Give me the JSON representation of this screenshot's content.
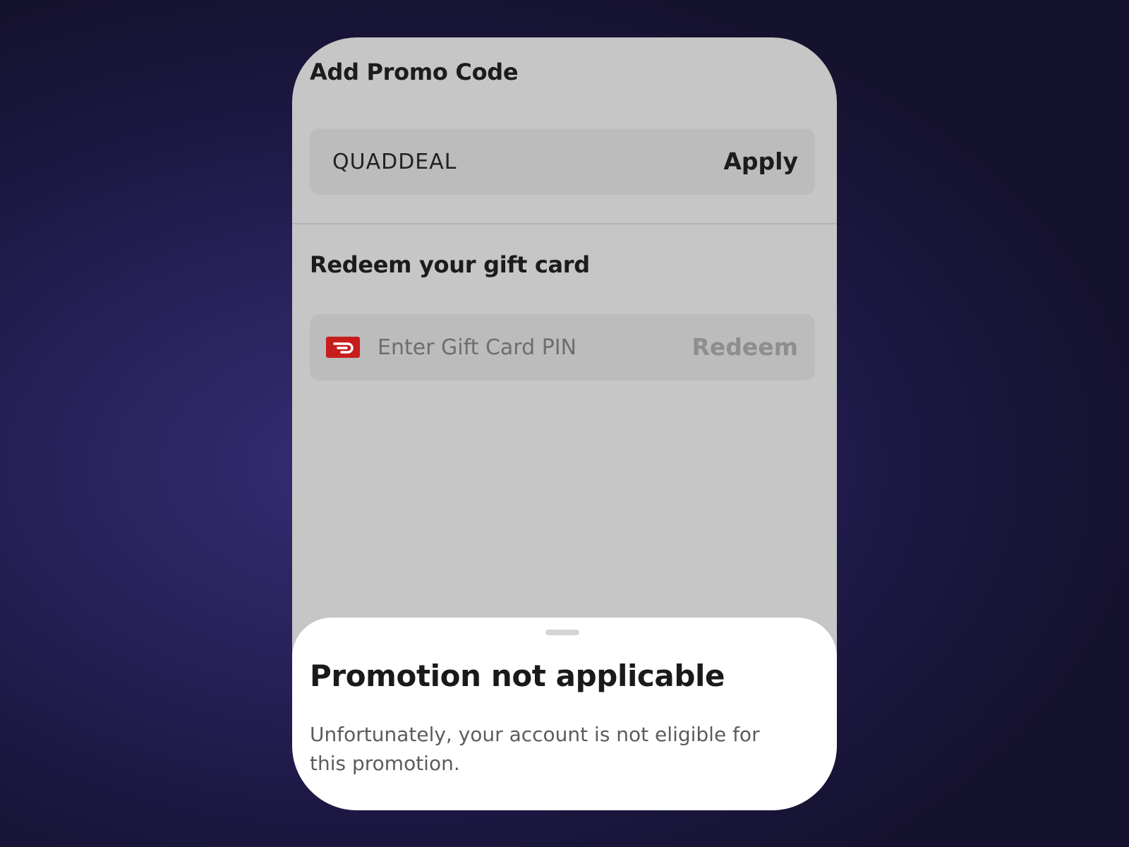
{
  "promo": {
    "title": "Add Promo Code",
    "code_value": "QUADDEAL",
    "apply_label": "Apply"
  },
  "gift_card": {
    "title": "Redeem your gift card",
    "pin_placeholder": "Enter Gift Card PIN",
    "redeem_label": "Redeem",
    "icon": "doordash-logo-icon"
  },
  "bottom_sheet": {
    "title": "Promotion not applicable",
    "message": "Unfortunately, your account is not eligible for this promotion."
  },
  "colors": {
    "brand_red": "#c81d1d",
    "background_dim": "#c6c6c6",
    "sheet_background": "#ffffff",
    "disabled_text": "#8e8e8e"
  }
}
